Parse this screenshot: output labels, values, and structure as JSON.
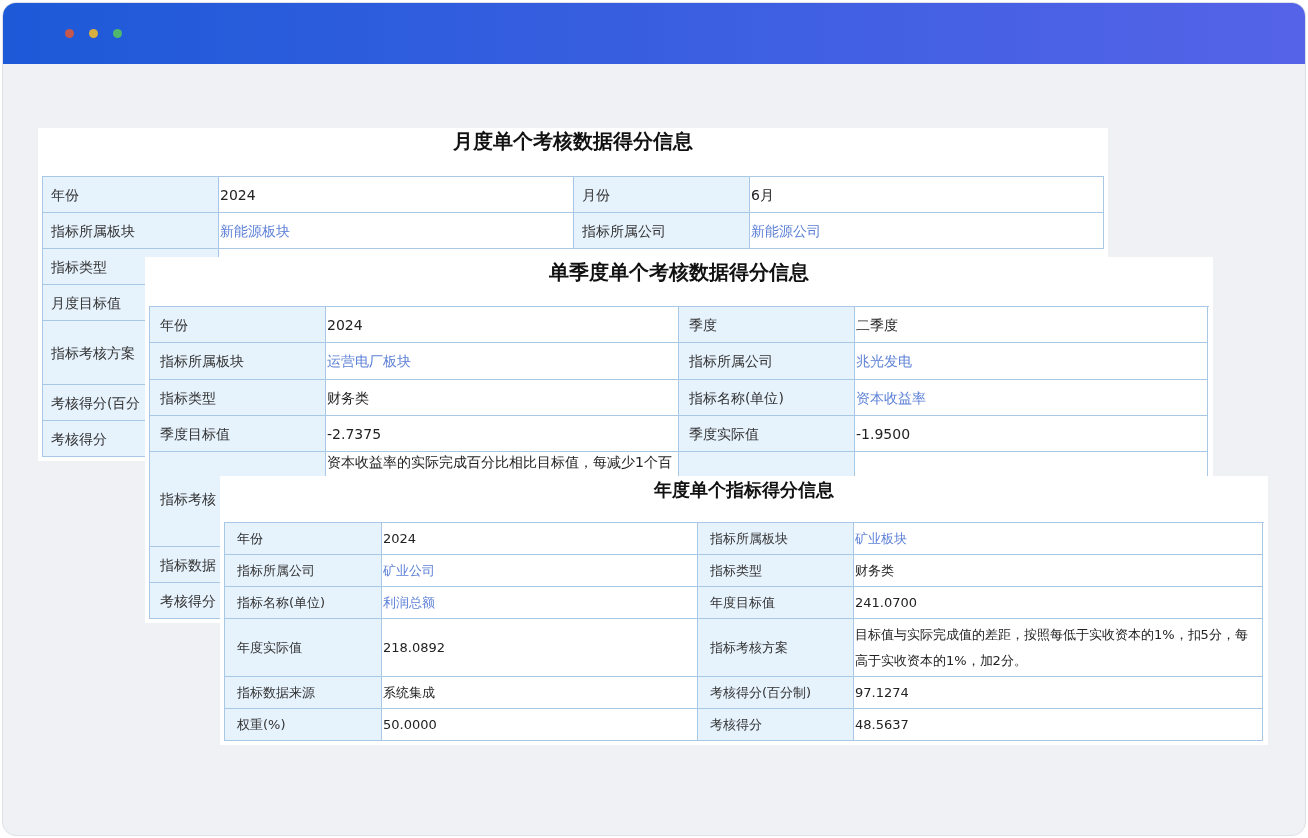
{
  "panels": [
    {
      "title": "月度单个考核数据得分信息",
      "rows": [
        {
          "cells": [
            {
              "kind": "label",
              "text": "年份"
            },
            {
              "kind": "text",
              "text": "2024"
            },
            {
              "kind": "label",
              "text": "月份"
            },
            {
              "kind": "text",
              "text": "6月"
            }
          ]
        },
        {
          "cells": [
            {
              "kind": "label",
              "text": "指标所属板块"
            },
            {
              "kind": "link",
              "text": "新能源板块"
            },
            {
              "kind": "label",
              "text": "指标所属公司"
            },
            {
              "kind": "link",
              "text": "新能源公司"
            }
          ]
        },
        {
          "cells": [
            {
              "kind": "label",
              "text": "指标类型"
            }
          ]
        },
        {
          "cells": [
            {
              "kind": "label",
              "text": "月度目标值"
            }
          ]
        },
        {
          "cells": [
            {
              "kind": "label",
              "text": "指标考核方案"
            }
          ]
        },
        {
          "cells": [
            {
              "kind": "label",
              "text": "考核得分(百分"
            }
          ]
        },
        {
          "cells": [
            {
              "kind": "label",
              "text": "考核得分"
            }
          ]
        }
      ]
    },
    {
      "title": "单季度单个考核数据得分信息",
      "rows": [
        {
          "cells": [
            {
              "kind": "label",
              "text": "年份"
            },
            {
              "kind": "text",
              "text": "2024"
            },
            {
              "kind": "label",
              "text": "季度"
            },
            {
              "kind": "text",
              "text": "二季度"
            }
          ]
        },
        {
          "cells": [
            {
              "kind": "label",
              "text": "指标所属板块"
            },
            {
              "kind": "link",
              "text": "运营电厂板块"
            },
            {
              "kind": "label",
              "text": "指标所属公司"
            },
            {
              "kind": "link",
              "text": "兆光发电"
            }
          ]
        },
        {
          "cells": [
            {
              "kind": "label",
              "text": "指标类型"
            },
            {
              "kind": "text",
              "text": "财务类"
            },
            {
              "kind": "label",
              "text": "指标名称(单位)"
            },
            {
              "kind": "link",
              "text": "资本收益率"
            }
          ]
        },
        {
          "cells": [
            {
              "kind": "label",
              "text": "季度目标值"
            },
            {
              "kind": "text",
              "text": "-2.7375"
            },
            {
              "kind": "label",
              "text": "季度实际值"
            },
            {
              "kind": "text",
              "text": "-1.9500"
            }
          ]
        },
        {
          "cells": [
            {
              "kind": "label",
              "text": "指标考核"
            },
            {
              "kind": "text",
              "text": "资本收益率的实际完成百分比相比目标值，每减少1个百"
            }
          ]
        },
        {
          "cells": [
            {
              "kind": "label",
              "text": "指标数据"
            }
          ]
        },
        {
          "cells": [
            {
              "kind": "label",
              "text": "考核得分"
            }
          ]
        }
      ]
    },
    {
      "title": "年度单个指标得分信息",
      "rows": [
        {
          "cells": [
            {
              "kind": "label",
              "text": "年份"
            },
            {
              "kind": "text",
              "text": "2024"
            },
            {
              "kind": "label",
              "text": "指标所属板块"
            },
            {
              "kind": "link",
              "text": "矿业板块"
            }
          ]
        },
        {
          "cells": [
            {
              "kind": "label",
              "text": "指标所属公司"
            },
            {
              "kind": "link",
              "text": "矿业公司"
            },
            {
              "kind": "label",
              "text": "指标类型"
            },
            {
              "kind": "text",
              "text": "财务类"
            }
          ]
        },
        {
          "cells": [
            {
              "kind": "label",
              "text": "指标名称(单位)"
            },
            {
              "kind": "link",
              "text": "利润总额"
            },
            {
              "kind": "label",
              "text": "年度目标值"
            },
            {
              "kind": "text",
              "text": "241.0700"
            }
          ]
        },
        {
          "cells": [
            {
              "kind": "label",
              "text": "年度实际值"
            },
            {
              "kind": "text",
              "text": "218.0892"
            },
            {
              "kind": "label",
              "text": "指标考核方案"
            },
            {
              "kind": "text",
              "text": "目标值与实际完成值的差距，按照每低于实收资本的1%，扣5分，每高于实收资本的1%，加2分。"
            }
          ]
        },
        {
          "cells": [
            {
              "kind": "label",
              "text": "指标数据来源"
            },
            {
              "kind": "text",
              "text": "系统集成"
            },
            {
              "kind": "label",
              "text": "考核得分(百分制)"
            },
            {
              "kind": "text",
              "text": "97.1274"
            }
          ]
        },
        {
          "cells": [
            {
              "kind": "label",
              "text": "权重(%)"
            },
            {
              "kind": "text",
              "text": "50.0000"
            },
            {
              "kind": "label",
              "text": "考核得分"
            },
            {
              "kind": "text",
              "text": "48.5637"
            }
          ]
        }
      ]
    }
  ]
}
